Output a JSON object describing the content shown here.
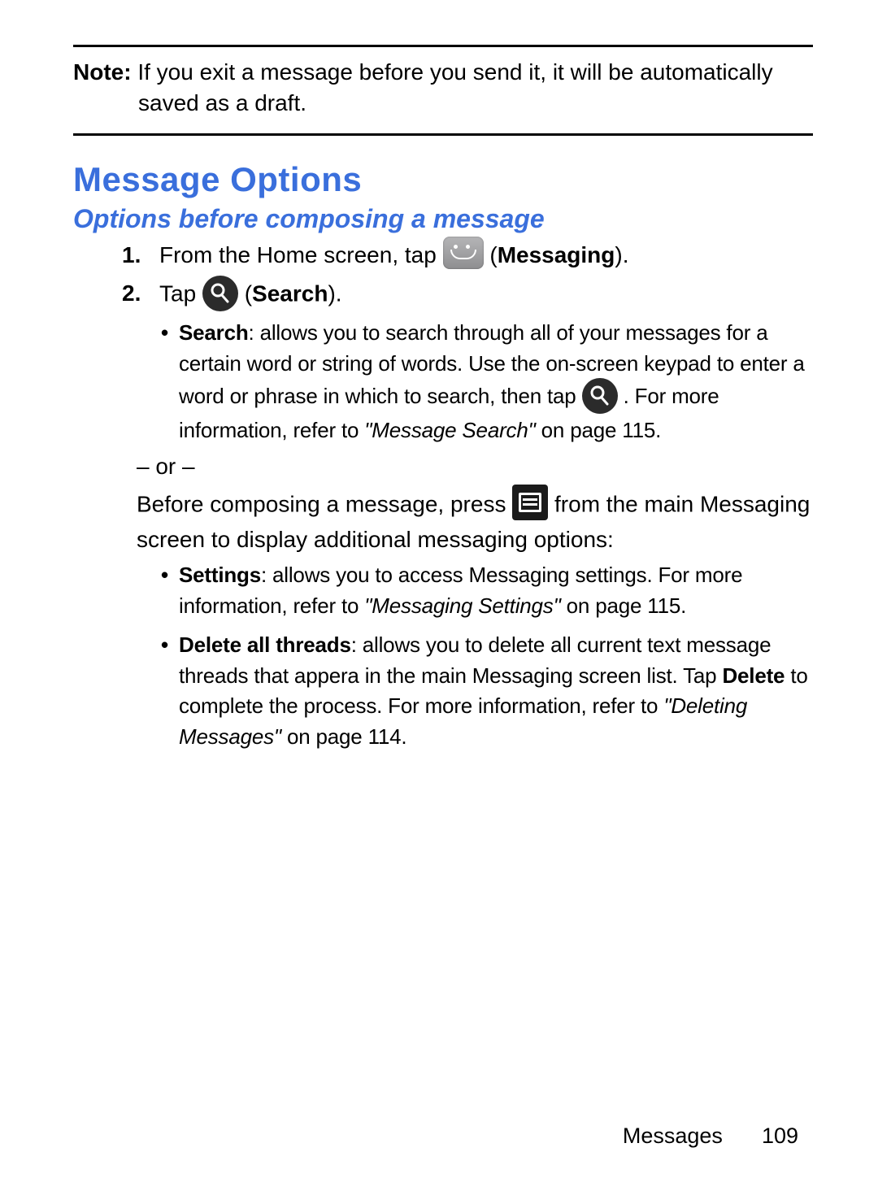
{
  "note": {
    "label": "Note:",
    "text": " If you exit a message before you send it, it will be automatically saved as a draft."
  },
  "heading1": "Message Options",
  "heading2": "Options before composing a message",
  "step1": {
    "num": "1.",
    "before": "From the Home screen, tap ",
    "after_open": " (",
    "bold": "Messaging",
    "after_close": ")."
  },
  "step2": {
    "num": "2.",
    "before": "Tap ",
    "after_open": " (",
    "bold": "Search",
    "after_close": ")."
  },
  "bullet_search": {
    "mark": "•",
    "lead_bold": "Search",
    "text1": ": allows you to search through all of your messages for a certain word or string of words. Use the on-screen keypad to enter a word or phrase in which to search, then tap ",
    "text2": " . For more information, refer to ",
    "ref": "\"Message Search\"",
    "text3": "  on page 115."
  },
  "or_line": "– or –",
  "continuation": {
    "before": "Before composing a message, press ",
    "after": " from the main Messaging screen to display additional messaging options:"
  },
  "bullet_settings": {
    "mark": "•",
    "lead_bold": "Settings",
    "text1": ": allows you to access Messaging settings. For more information, refer to ",
    "ref": "\"Messaging Settings\"",
    "text2": "  on page 115."
  },
  "bullet_delete": {
    "mark": "•",
    "lead_bold": "Delete all threads",
    "text1": ": allows you to delete all current text message threads that appera in the main Messaging screen list. Tap ",
    "bold_inside": "Delete",
    "text2": " to complete the process. For more information, refer to ",
    "ref": "\"Deleting Messages\"",
    "text3": "  on page 114."
  },
  "footer": {
    "section": "Messages",
    "page": "109"
  }
}
